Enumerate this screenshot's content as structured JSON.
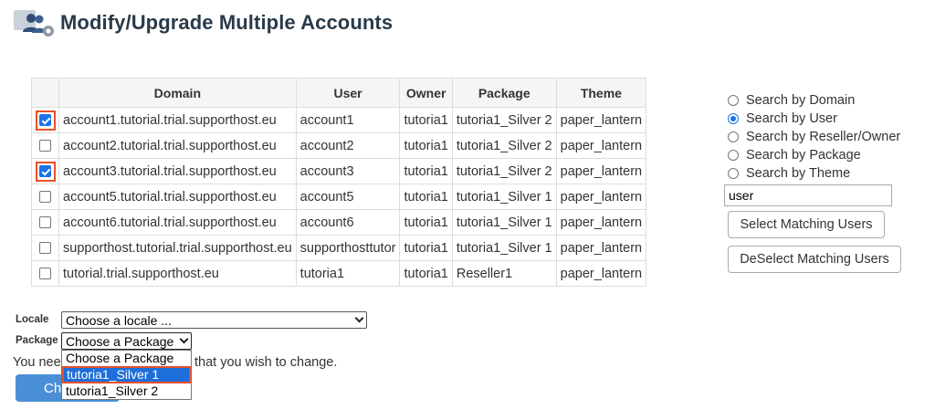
{
  "header": {
    "title": "Modify/Upgrade Multiple Accounts",
    "icon": "users-gear-icon"
  },
  "table": {
    "columns": [
      "",
      "Domain",
      "User",
      "Owner",
      "Package",
      "Theme"
    ],
    "rows": [
      {
        "checked": true,
        "highlighted": true,
        "domain": "account1.tutorial.trial.supporthost.eu",
        "user": "account1",
        "owner": "tutoria1",
        "package": "tutoria1_Silver 2",
        "theme": "paper_lantern"
      },
      {
        "checked": false,
        "highlighted": false,
        "domain": "account2.tutorial.trial.supporthost.eu",
        "user": "account2",
        "owner": "tutoria1",
        "package": "tutoria1_Silver 2",
        "theme": "paper_lantern"
      },
      {
        "checked": true,
        "highlighted": true,
        "domain": "account3.tutorial.trial.supporthost.eu",
        "user": "account3",
        "owner": "tutoria1",
        "package": "tutoria1_Silver 2",
        "theme": "paper_lantern"
      },
      {
        "checked": false,
        "highlighted": false,
        "domain": "account5.tutorial.trial.supporthost.eu",
        "user": "account5",
        "owner": "tutoria1",
        "package": "tutoria1_Silver 1",
        "theme": "paper_lantern"
      },
      {
        "checked": false,
        "highlighted": false,
        "domain": "account6.tutorial.trial.supporthost.eu",
        "user": "account6",
        "owner": "tutoria1",
        "package": "tutoria1_Silver 1",
        "theme": "paper_lantern"
      },
      {
        "checked": false,
        "highlighted": false,
        "domain": "supporthost.tutorial.trial.supporthost.eu",
        "user": "supporthosttutor",
        "owner": "tutoria1",
        "package": "tutoria1_Silver 1",
        "theme": "paper_lantern"
      },
      {
        "checked": false,
        "highlighted": false,
        "domain": "tutorial.trial.supporthost.eu",
        "user": "tutoria1",
        "owner": "tutoria1",
        "package": "Reseller1",
        "theme": "paper_lantern"
      }
    ]
  },
  "search": {
    "options": [
      {
        "label": "Search by Domain",
        "selected": false
      },
      {
        "label": "Search by User",
        "selected": true
      },
      {
        "label": "Search by Reseller/Owner",
        "selected": false
      },
      {
        "label": "Search by Package",
        "selected": false
      },
      {
        "label": "Search by Theme",
        "selected": false
      }
    ],
    "value": "user",
    "select_button": "Select Matching Users",
    "deselect_button": "DeSelect Matching Users"
  },
  "form": {
    "locale_label": "Locale",
    "locale_value": "Choose a locale ...",
    "package_label": "Package",
    "package_value": "Choose a Package",
    "help_text_start": "You nee",
    "help_text_end": "that you wish to change.",
    "change_button": "Ch",
    "package_options": [
      {
        "label": "Choose a Package",
        "active": false
      },
      {
        "label": "tutoria1_Silver 1",
        "active": true
      },
      {
        "label": "tutoria1_Silver 2",
        "active": false
      }
    ]
  },
  "colors": {
    "accent": "#1a73e8",
    "highlight": "#e8502a",
    "primary_button": "#4a8fd6"
  }
}
